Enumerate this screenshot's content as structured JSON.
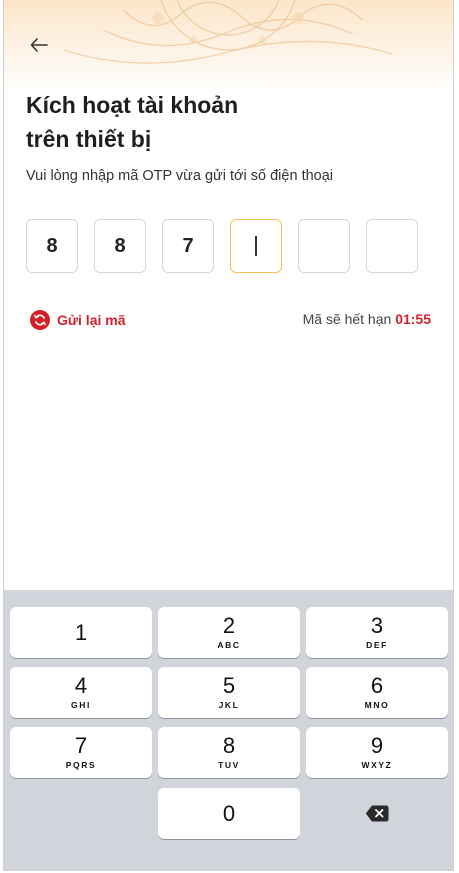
{
  "header": {
    "title_line1": "Kích hoạt tài khoản",
    "title_line2": "trên thiết bị",
    "subtitle": "Vui lòng nhập mã OTP vừa gửi tới số điện thoại"
  },
  "otp": {
    "digits": [
      "8",
      "8",
      "7",
      "",
      "",
      ""
    ],
    "active_index": 3,
    "active_border_color": "#f2c44f"
  },
  "resend": {
    "label": "Gửi lại mã",
    "color": "#d3202a"
  },
  "expiry": {
    "prefix": "Mã sẽ hết hạn",
    "time": "01:55",
    "time_color": "#d3202a"
  },
  "keypad": {
    "keys": [
      {
        "num": "1",
        "letters": ""
      },
      {
        "num": "2",
        "letters": "ABC"
      },
      {
        "num": "3",
        "letters": "DEF"
      },
      {
        "num": "4",
        "letters": "GHI"
      },
      {
        "num": "5",
        "letters": "JKL"
      },
      {
        "num": "6",
        "letters": "MNO"
      },
      {
        "num": "7",
        "letters": "PQRS"
      },
      {
        "num": "8",
        "letters": "TUV"
      },
      {
        "num": "9",
        "letters": "WXYZ"
      },
      {
        "num": "0",
        "letters": ""
      }
    ],
    "delete_icon": "backspace-icon",
    "background_color": "#d1d4da"
  }
}
